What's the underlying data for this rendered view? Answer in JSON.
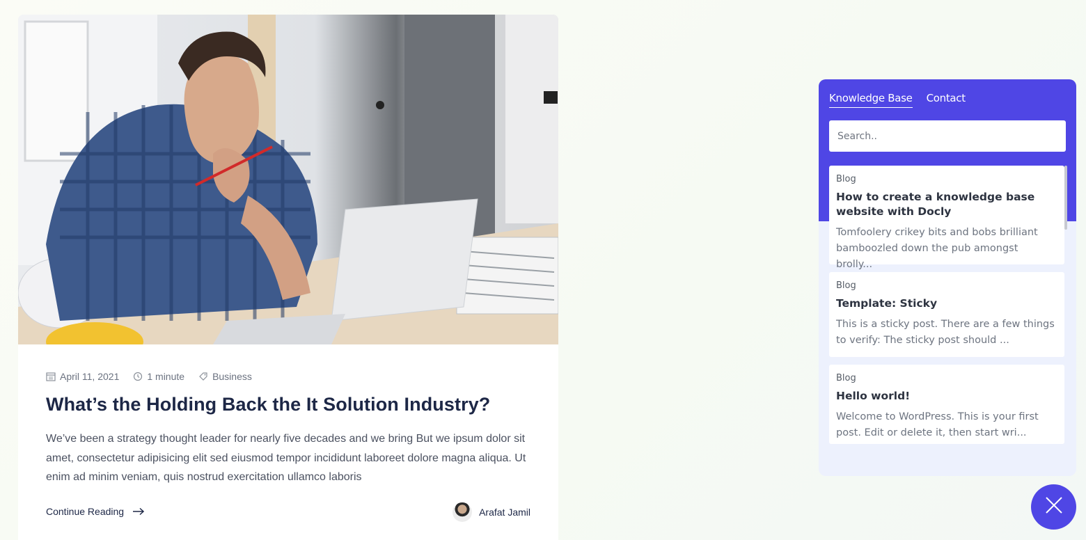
{
  "post": {
    "date": "April 11, 2021",
    "read_time": "1 minute",
    "category": "Business",
    "title": "What’s the Holding Back the It Solution Industry?",
    "excerpt": "We’ve been a strategy thought leader for nearly five decades and we bring But we ipsum dolor sit amet, consectetur adipisicing elit sed eiusmod tempor incididunt laboreet dolore magna aliqua. Ut enim ad minim veniam, quis nostrud exercitation ullamco laboris",
    "continue_label": "Continue Reading",
    "author": "Arafat Jamil",
    "icons": {
      "date": "calendar-icon",
      "time": "clock-icon",
      "category": "tag-icon",
      "continue": "arrow-right-icon"
    }
  },
  "widget": {
    "tabs": [
      {
        "label": "Knowledge Base",
        "active": true
      },
      {
        "label": "Contact",
        "active": false
      }
    ],
    "search_placeholder": "Search..",
    "results": [
      {
        "category": "Blog",
        "title": "How to create a knowledge base website with Docly",
        "excerpt": "Tomfoolery crikey bits and bobs brilliant bamboozled down the pub amongst brolly..."
      },
      {
        "category": "Blog",
        "title": "Template: Sticky",
        "excerpt": "This is a sticky post. There are a few things to verify: The sticky post should ..."
      },
      {
        "category": "Blog",
        "title": "Hello world!",
        "excerpt": "Welcome to WordPress. This is your first post. Edit or delete it, then start wri..."
      }
    ],
    "close_icon": "close-icon"
  },
  "colors": {
    "accent": "#4f46e5",
    "title": "#1d2746",
    "widget_bg": "#edf1fd"
  }
}
